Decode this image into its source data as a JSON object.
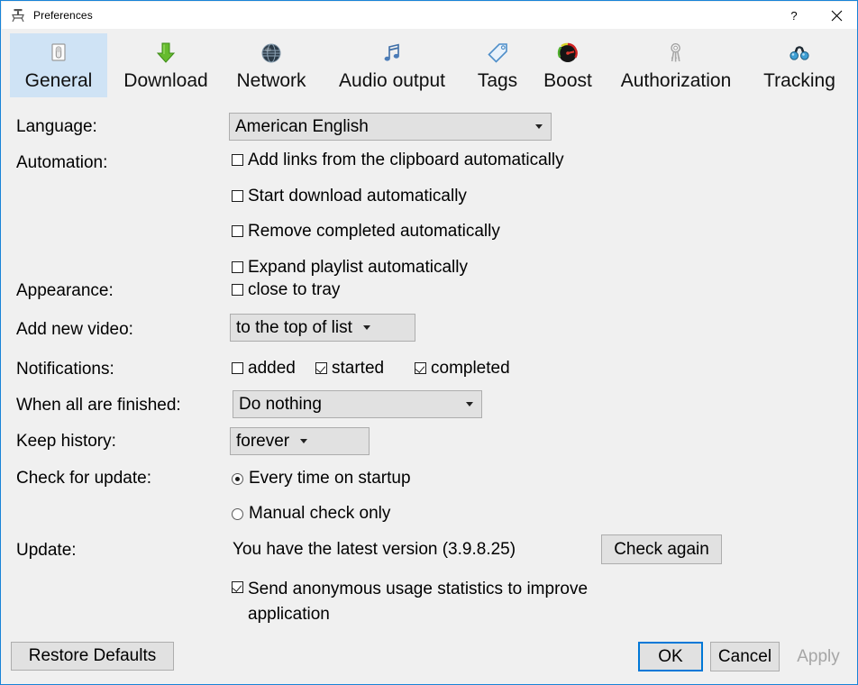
{
  "window": {
    "title": "Preferences",
    "icon": "app-icon",
    "help_label": "?",
    "close_label": "✕",
    "accent_color": "#1883d7",
    "selected_tab_color": "#cfe3f5"
  },
  "tabs": [
    {
      "label": "General",
      "icon": "switch-icon",
      "selected": true
    },
    {
      "label": "Download",
      "icon": "download-arrow-icon",
      "selected": false
    },
    {
      "label": "Network",
      "icon": "globe-icon",
      "selected": false
    },
    {
      "label": "Audio output",
      "icon": "music-note-icon",
      "selected": false
    },
    {
      "label": "Tags",
      "icon": "tag-icon",
      "selected": false
    },
    {
      "label": "Boost",
      "icon": "speedometer-icon",
      "selected": false
    },
    {
      "label": "Authorization",
      "icon": "keys-icon",
      "selected": false
    },
    {
      "label": "Tracking",
      "icon": "binoculars-icon",
      "selected": false
    }
  ],
  "form": {
    "language": {
      "label": "Language:",
      "value": "American English"
    },
    "automation": {
      "label": "Automation:",
      "options": [
        {
          "label": "Add links from the clipboard automatically",
          "checked": false
        },
        {
          "label": "Start download automatically",
          "checked": false
        },
        {
          "label": "Remove completed automatically",
          "checked": false
        },
        {
          "label": "Expand playlist automatically",
          "checked": false
        }
      ]
    },
    "appearance": {
      "label": "Appearance:",
      "close_to_tray": {
        "label": "close to tray",
        "checked": false
      }
    },
    "add_new_video": {
      "label": "Add new video:",
      "value": "to the top of list"
    },
    "notifications": {
      "label": "Notifications:",
      "options": [
        {
          "label": "added",
          "checked": false
        },
        {
          "label": "started",
          "checked": true
        },
        {
          "label": "completed",
          "checked": true
        }
      ]
    },
    "when_all_finished": {
      "label": "When all are finished:",
      "value": "Do nothing"
    },
    "keep_history": {
      "label": "Keep history:",
      "value": "forever"
    },
    "check_for_update": {
      "label": "Check for update:",
      "options": [
        {
          "label": "Every time on startup",
          "selected": true
        },
        {
          "label": "Manual check only",
          "selected": false
        }
      ]
    },
    "update": {
      "label": "Update:",
      "status": "You have the latest version (3.9.8.25)",
      "check_again_label": "Check again",
      "telemetry": {
        "label": "Send anonymous usage statistics to improve application",
        "checked": true
      }
    }
  },
  "footer": {
    "restore_defaults_label": "Restore Defaults",
    "ok_label": "OK",
    "cancel_label": "Cancel",
    "apply_label": "Apply"
  }
}
